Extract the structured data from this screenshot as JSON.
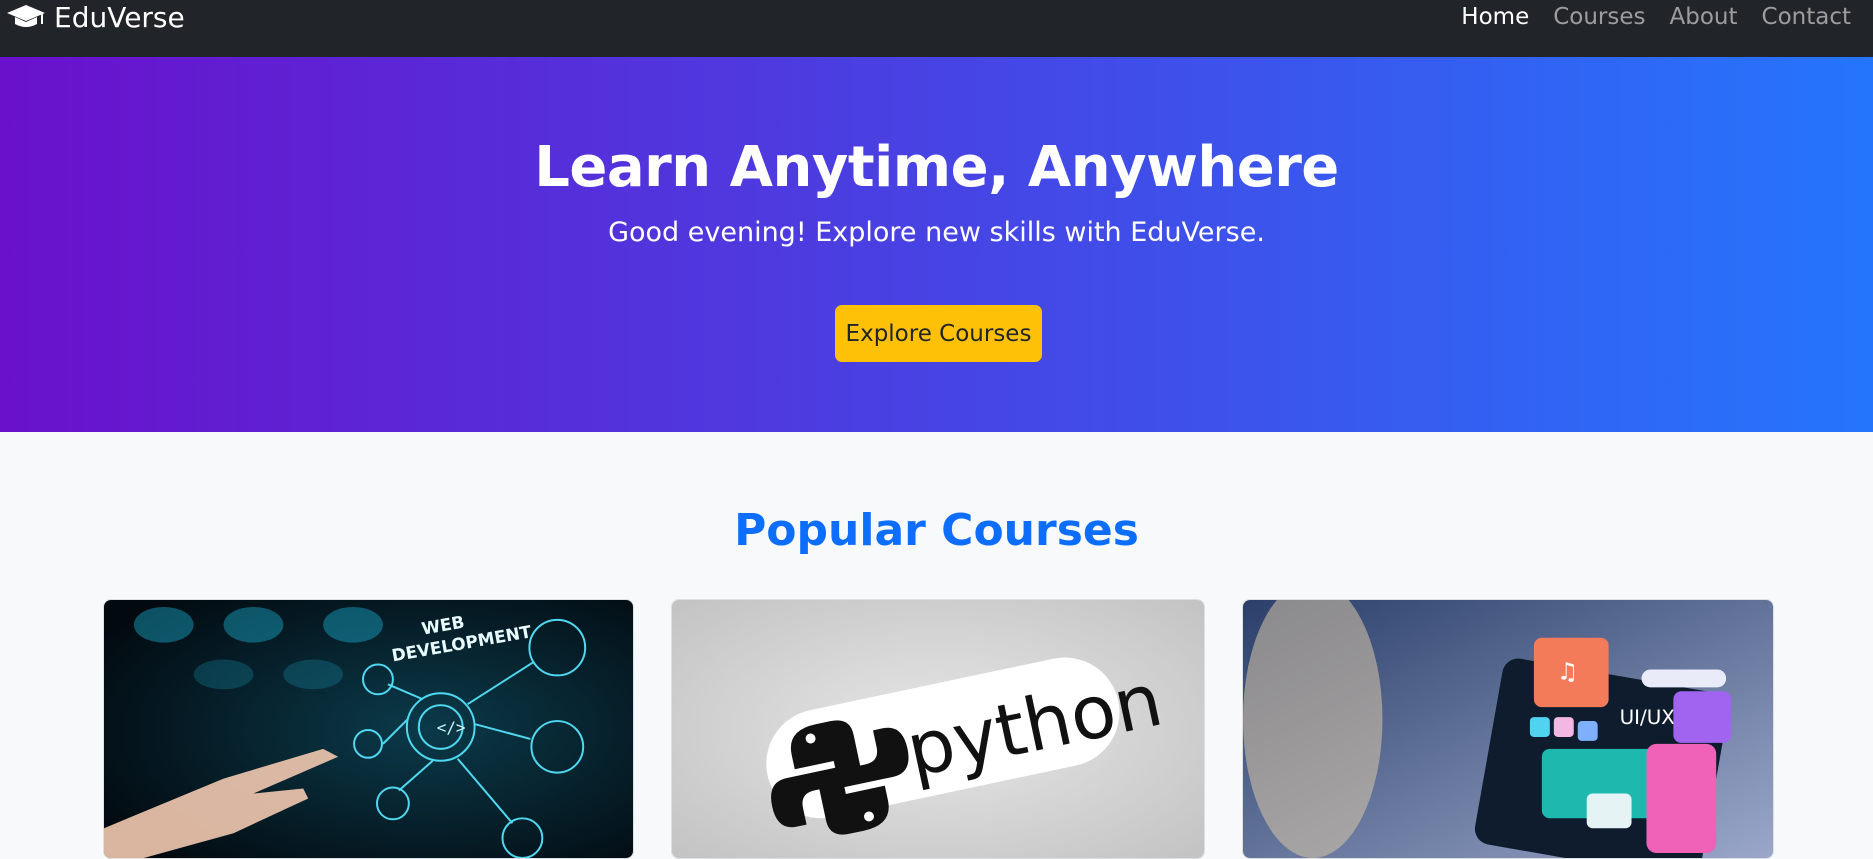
{
  "nav": {
    "brand": "EduVerse",
    "links": [
      {
        "label": "Home",
        "active": true
      },
      {
        "label": "Courses",
        "active": false
      },
      {
        "label": "About",
        "active": false
      },
      {
        "label": "Contact",
        "active": false
      }
    ]
  },
  "hero": {
    "title": "Learn Anytime, Anywhere",
    "subtitle": "Good evening! Explore new skills with EduVerse.",
    "button_label": "Explore Courses",
    "gradient_start": "#6a11cb",
    "gradient_end": "#2575fc"
  },
  "courses": {
    "section_title": "Popular Courses",
    "cards": [
      {
        "image_text_line1": "WEB",
        "image_text_line2": "DEVELOPMENT",
        "icon": "web-development-image"
      },
      {
        "image_text": "python",
        "icon": "python-logo-image"
      },
      {
        "image_text": "UI/UX",
        "icon": "ui-ux-image"
      }
    ]
  },
  "colors": {
    "navbar": "#212529",
    "accent": "#0d6efd",
    "button": "#ffc107",
    "page_bg": "#f8f9fa"
  }
}
